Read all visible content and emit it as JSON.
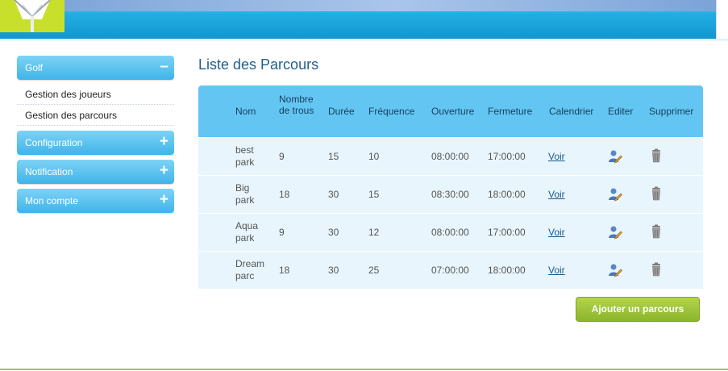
{
  "sidebar": {
    "sections": [
      {
        "label": "Golf",
        "sign": "–"
      },
      {
        "label": "Configuration",
        "sign": "+"
      },
      {
        "label": "Notification",
        "sign": "+"
      },
      {
        "label": "Mon compte",
        "sign": "+"
      }
    ],
    "golf_items": [
      {
        "label": "Gestion des joueurs"
      },
      {
        "label": "Gestion des parcours"
      }
    ]
  },
  "main": {
    "title": "Liste des Parcours",
    "columns": [
      "Nom",
      "Nombre de trous",
      "Durée",
      "Fréquence",
      "Ouverture",
      "Fermeture",
      "Calendrier",
      "Editer",
      "Supprimer"
    ],
    "rows": [
      {
        "nom": [
          "best",
          "park"
        ],
        "trous": "9",
        "duree": "15",
        "frequence": "10",
        "ouverture": "08:00:00",
        "fermeture": "17:00:00",
        "calendrier": "Voir"
      },
      {
        "nom": [
          "Big",
          "park"
        ],
        "trous": "18",
        "duree": "30",
        "frequence": "15",
        "ouverture": "08:30:00",
        "fermeture": "18:00:00",
        "calendrier": "Voir"
      },
      {
        "nom": [
          "Aqua",
          "park"
        ],
        "trous": "9",
        "duree": "30",
        "frequence": "12",
        "ouverture": "08:00:00",
        "fermeture": "17:00:00",
        "calendrier": "Voir"
      },
      {
        "nom": [
          "Dream",
          "parc"
        ],
        "trous": "18",
        "duree": "30",
        "frequence": "25",
        "ouverture": "07:00:00",
        "fermeture": "18:00:00",
        "calendrier": "Voir"
      }
    ],
    "add_button": "Ajouter un parcours",
    "icons": {
      "edit": "edit-user-icon",
      "delete": "trash-icon"
    }
  },
  "colors": {
    "header": "#1a9fd6",
    "accent": "#4fbdee",
    "button": "#9dc33a",
    "title": "#1f5f8c"
  }
}
